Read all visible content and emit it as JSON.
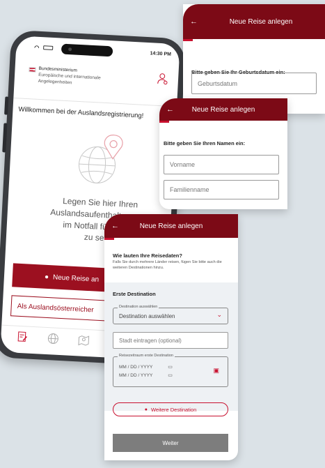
{
  "phone": {
    "status_time": "14:30 PM",
    "ministry_line1": "Bundesministerium",
    "ministry_line2": "Europäische und internationale",
    "ministry_line3": "Angelegenheiten",
    "welcome": "Willkommen bei der Auslandsregistrierung!",
    "lead_line1": "Legen Sie hier Ihren",
    "lead_line2": "Auslandsaufenthalt an, um",
    "lead_line3": "im Notfall für uns er",
    "lead_line4": "zu sein.",
    "primary_button": "Neue Reise an",
    "secondary_button": "Als Auslandsösterreicher"
  },
  "card_birth": {
    "title": "Neue Reise anlegen",
    "prompt": "Bitte geben Sie Ihr Geburtsdatum ein:",
    "placeholder": "Geburtsdatum"
  },
  "card_name": {
    "title": "Neue Reise anlegen",
    "prompt": "Bitte geben Sie Ihren Namen ein:",
    "first_placeholder": "Vorname",
    "last_placeholder": "Familienname"
  },
  "card_travel": {
    "title": "Neue Reise anlegen",
    "question": "Wie lauten Ihre Reisedaten?",
    "hint": "Falls Sie durch mehrere Länder reisen, fügen Sie bitte auch die weiteren Destinationen hinzu.",
    "section": "Erste Destination",
    "select_label": "Destination auswählen",
    "select_value": "Destination auswählen",
    "city_placeholder": "Stadt eintragen (optional)",
    "period_label": "Reisezeitraum erste Destination",
    "date_from": "MM / DD / YYYY",
    "date_to": "MM / DD / YYYY",
    "add_destination": "Weitere Destination",
    "next": "Weiter"
  },
  "colors": {
    "brand_dark": "#7c0a16",
    "brand": "#c8102e",
    "button": "#9c1020"
  }
}
